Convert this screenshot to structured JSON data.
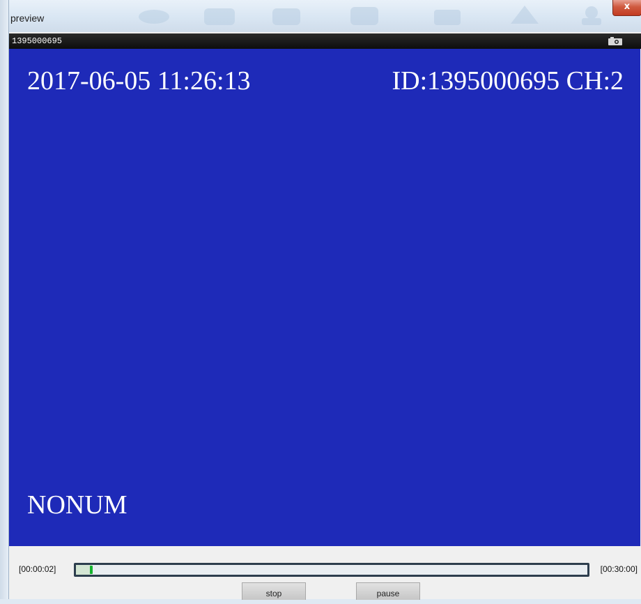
{
  "window": {
    "title": "preview",
    "close_label": "x"
  },
  "video": {
    "device_id": "1395000695",
    "osd_datetime": "2017-06-05 11:26:13",
    "osd_id_channel": "ID:1395000695 CH:2",
    "osd_status": "NONUM",
    "background_color": "#1e2ab8"
  },
  "playback": {
    "elapsed": "[00:00:02]",
    "total": "[00:30:00]",
    "progress_fraction": 0.0011,
    "stop_label": "stop",
    "pause_label": "pause"
  },
  "icons": {
    "snapshot": "camera-icon",
    "close": "close-icon"
  }
}
